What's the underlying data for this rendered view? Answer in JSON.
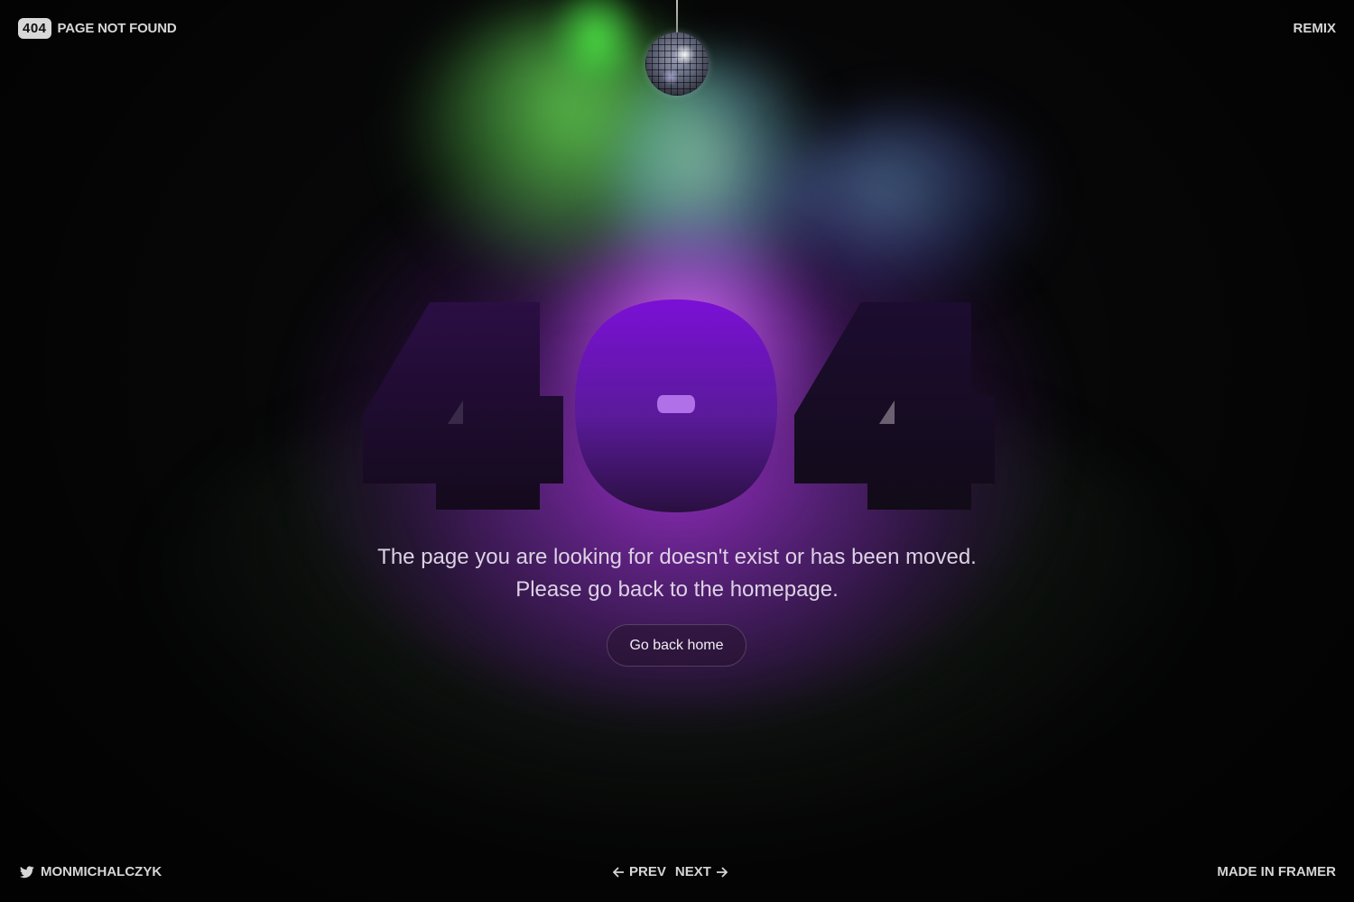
{
  "header": {
    "badge": "404",
    "title": "PAGE NOT FOUND",
    "remix_label": "REMIX"
  },
  "hero": {
    "big_text": "404",
    "message": "The page you are looking for doesn't exist or has been moved. Please go back to the homepage.",
    "button_label": "Go back home"
  },
  "footer": {
    "social_icon": "twitter-icon",
    "social_handle": "MONMICHALCZYK",
    "prev_label": "PREV",
    "next_label": "NEXT",
    "made_in": "MADE IN FRAMER"
  },
  "colors": {
    "background": "#070708",
    "accent_purple": "#a032dc",
    "accent_green": "#6ee65a",
    "text_light": "#d6d6d6"
  }
}
